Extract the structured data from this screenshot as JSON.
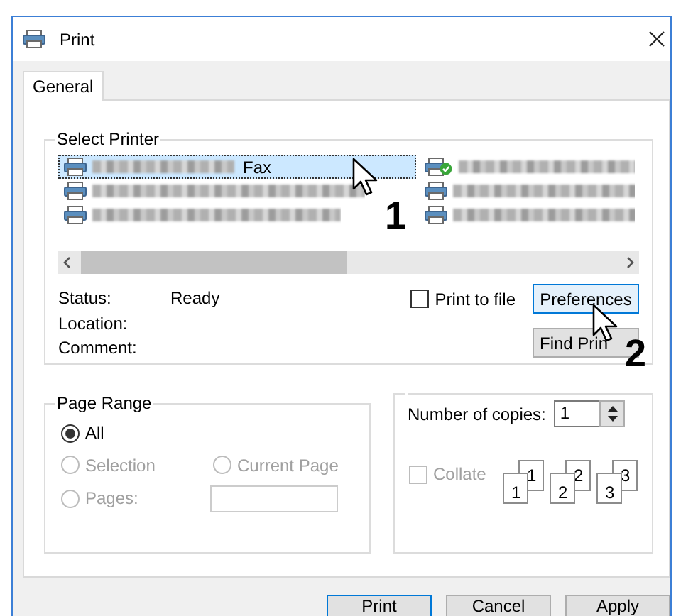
{
  "window": {
    "title": "Print"
  },
  "tabs": [
    {
      "label": "General",
      "selected": true
    }
  ],
  "select_printer": {
    "title": "Select Printer",
    "printers": [
      {
        "label": "Fax",
        "selected": true,
        "default": false
      },
      {
        "selected": false,
        "default": false
      },
      {
        "selected": false,
        "default": false
      },
      {
        "selected": false,
        "default": true
      },
      {
        "selected": false,
        "default": false
      },
      {
        "selected": false,
        "default": false
      }
    ],
    "status": [
      {
        "label": "Status:",
        "value": "Ready"
      },
      {
        "label": "Location:"
      },
      {
        "label": "Comment:"
      }
    ],
    "print_to_file": {
      "label": "Print to file",
      "checked": false
    },
    "buttons": [
      {
        "label": "Preferences",
        "hovered": true
      },
      {
        "label": "Find Prin",
        "hovered": false
      }
    ]
  },
  "page_range": {
    "title": "Page Range",
    "options": [
      {
        "label": "All",
        "selected": true,
        "disabled": false
      },
      {
        "label": "Selection",
        "selected": false,
        "disabled": true
      },
      {
        "label": "Current Page",
        "selected": false,
        "disabled": true
      },
      {
        "label": "Pages:",
        "selected": false,
        "disabled": true
      }
    ],
    "pages_field": {
      "disabled": true
    }
  },
  "copies": {
    "label": "Number of copies:",
    "value": "1",
    "collate": {
      "label": "Collate",
      "checked": false,
      "disabled": true
    },
    "collate_sets": [
      {
        "back": "1",
        "front": "1"
      },
      {
        "back": "2",
        "front": "2"
      },
      {
        "back": "3",
        "front": "3"
      }
    ]
  },
  "footer_buttons": [
    {
      "label": "Print",
      "default": true
    },
    {
      "label": "Cancel",
      "default": false
    },
    {
      "label": "Apply",
      "default": false
    }
  ],
  "callouts": [
    {
      "number": "1"
    },
    {
      "number": "2"
    }
  ]
}
